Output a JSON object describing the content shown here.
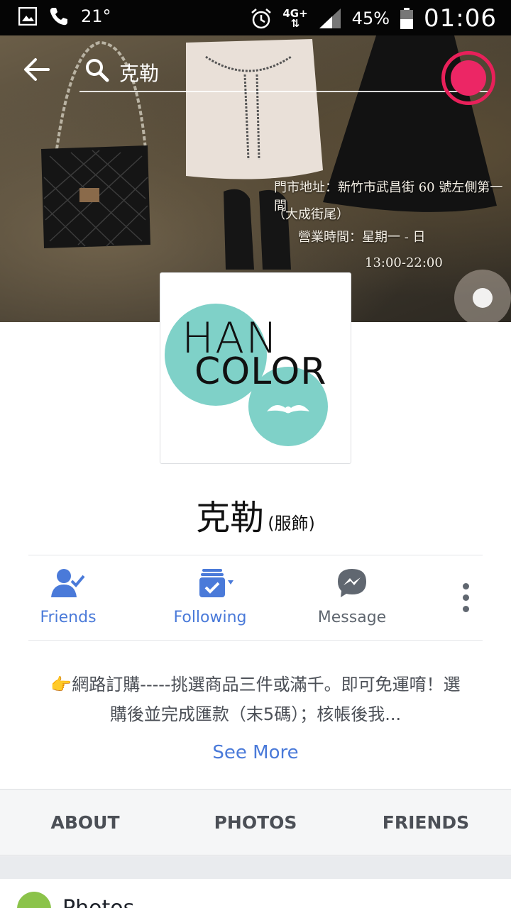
{
  "status_bar": {
    "temperature": "21°",
    "network": "4G+",
    "battery": "45%",
    "time": "01:06"
  },
  "search": {
    "query": "克勒"
  },
  "cover": {
    "line1": "門市地址：新竹市武昌街 60 號左側第一間",
    "line2": "（大成街尾）",
    "line3": "營業時間：星期一 - 日",
    "line4": "13:00-22:00"
  },
  "logo": {
    "line1": "HAN",
    "line2": "COLOR"
  },
  "page": {
    "name": "克勒",
    "category": "(服飾)"
  },
  "actions": {
    "friends": "Friends",
    "following": "Following",
    "message": "Message"
  },
  "about": {
    "text": "👉網路訂購-----挑選商品三件或滿千。即可免運唷！選購後並完成匯款（末5碼）；核帳後我...",
    "see_more": "See More"
  },
  "tabs": [
    "ABOUT",
    "PHOTOS",
    "FRIENDS"
  ],
  "section": {
    "title": "Photos"
  },
  "colors": {
    "accent": "#4a7ad9",
    "record": "#ec2665",
    "logo_teal": "#7fd1c8"
  }
}
